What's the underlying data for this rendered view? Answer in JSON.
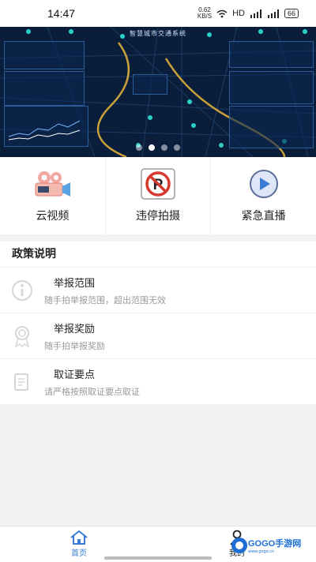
{
  "status_bar": {
    "time": "14:47",
    "net_speed_value": "0.62",
    "net_speed_unit": "KB/S",
    "hd": "HD",
    "battery": "66"
  },
  "banner": {
    "title": "智慧城市交通系统",
    "active_slide": 2,
    "slide_count": 4
  },
  "quick_actions": [
    {
      "label": "云视频",
      "icon": "video-camera-icon"
    },
    {
      "label": "违停拍摄",
      "icon": "no-parking-icon"
    },
    {
      "label": "紧急直播",
      "icon": "play-icon"
    }
  ],
  "policy": {
    "title": "政策说明",
    "items": [
      {
        "title": "举报范围",
        "subtitle": "随手拍举报范围，超出范围无效",
        "icon": "info-icon"
      },
      {
        "title": "举报奖励",
        "subtitle": "随手拍举报奖励",
        "icon": "award-icon"
      },
      {
        "title": "取证要点",
        "subtitle": "请严格按照取证要点取证",
        "icon": "document-icon"
      }
    ]
  },
  "tabs": [
    {
      "label": "首页",
      "icon": "home-icon",
      "active": true
    },
    {
      "label": "我的",
      "icon": "user-icon",
      "active": false
    }
  ],
  "watermark": {
    "text": "GOGO手游网",
    "sub": "www.gogo.cn"
  },
  "colors": {
    "accent": "#3a7bd5",
    "banner_bg": "#081a33",
    "no_parking_red": "#d63a2f"
  }
}
